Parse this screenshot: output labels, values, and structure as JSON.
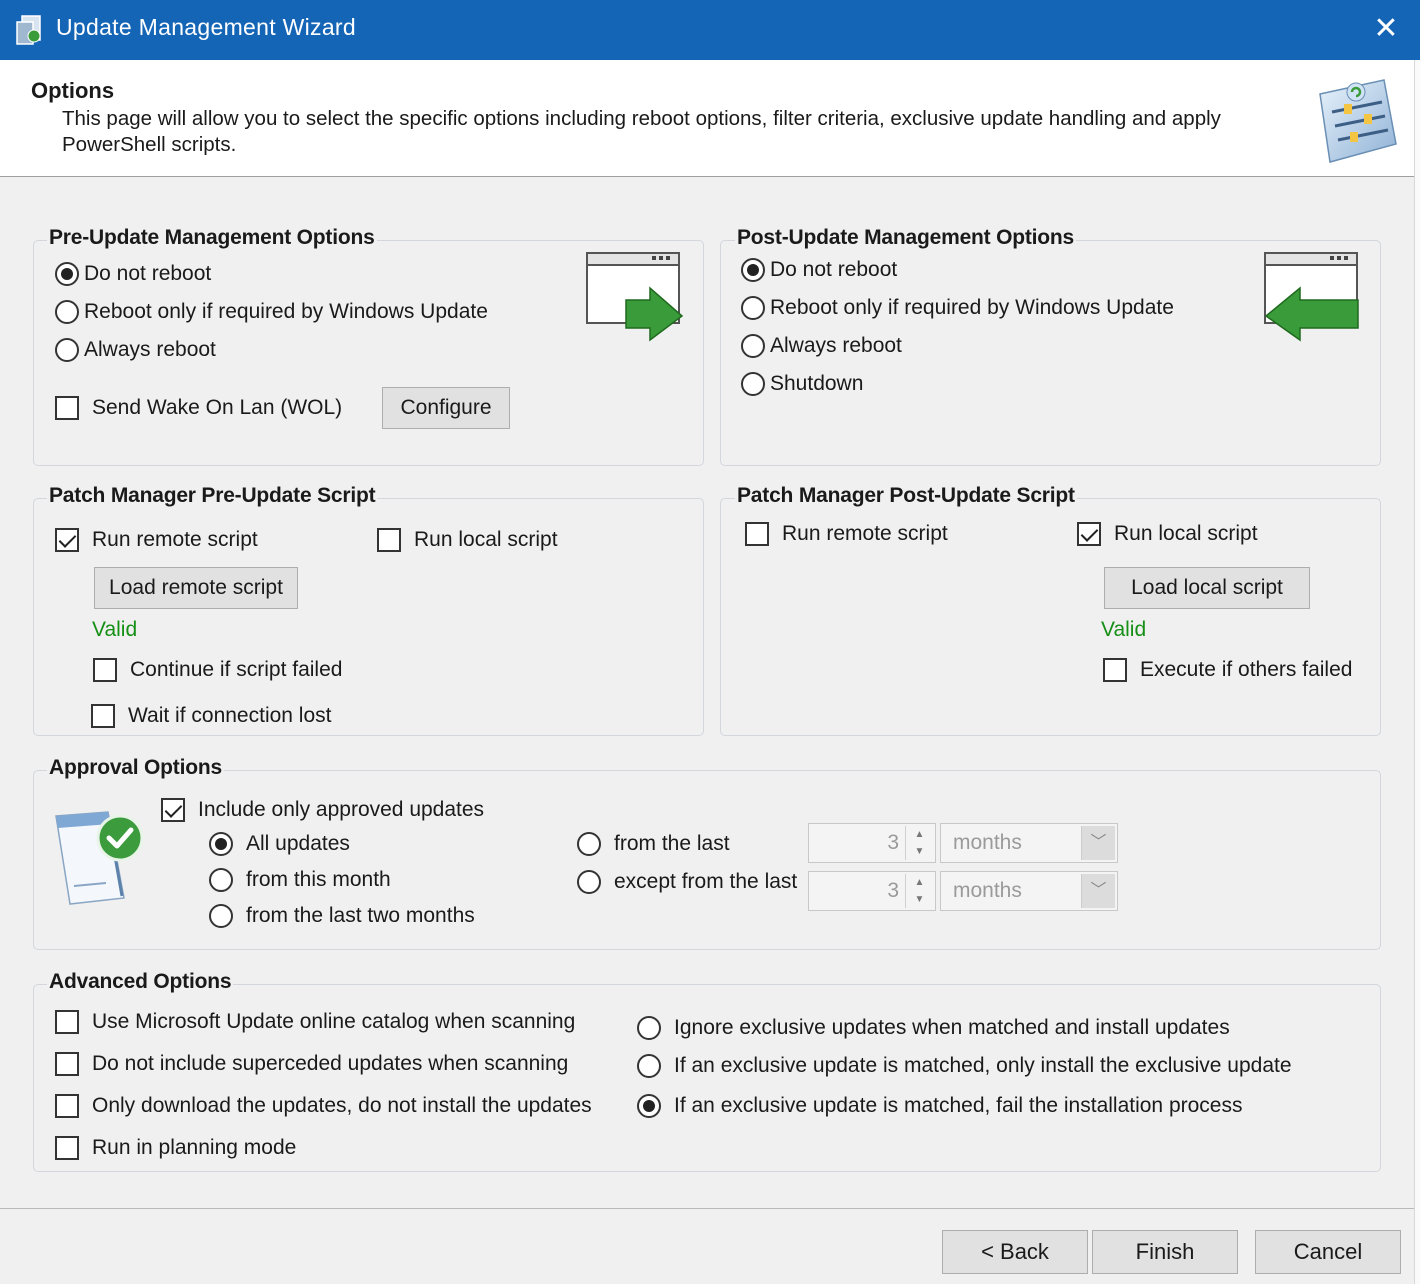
{
  "window": {
    "title": "Update Management Wizard",
    "close_glyph": "✕",
    "title_bar_color": "#1565b7"
  },
  "header": {
    "title": "Options",
    "description": "This page will allow you to select the specific options including reboot options, filter criteria, exclusive update handling and apply PowerShell scripts."
  },
  "pre_update": {
    "title": "Pre-Update Management Options",
    "options": [
      {
        "label": "Do not reboot",
        "selected": true
      },
      {
        "label": "Reboot only if required by Windows Update",
        "selected": false
      },
      {
        "label": "Always reboot",
        "selected": false
      }
    ],
    "wol_label": "Send Wake On Lan (WOL)",
    "wol_checked": false,
    "configure_label": "Configure"
  },
  "post_update": {
    "title": "Post-Update Management Options",
    "options": [
      {
        "label": "Do not reboot",
        "selected": true
      },
      {
        "label": "Reboot only if required by Windows Update",
        "selected": false
      },
      {
        "label": "Always reboot",
        "selected": false
      },
      {
        "label": "Shutdown",
        "selected": false
      }
    ]
  },
  "pre_script": {
    "title": "Patch Manager Pre-Update Script",
    "run_remote_label": "Run remote script",
    "run_remote_checked": true,
    "run_local_label": "Run local script",
    "run_local_checked": false,
    "load_label": "Load remote script",
    "status": "Valid",
    "continue_label": "Continue if script failed",
    "wait_label": "Wait if connection lost"
  },
  "post_script": {
    "title": "Patch Manager Post-Update Script",
    "run_remote_label": "Run remote script",
    "run_remote_checked": false,
    "run_local_label": "Run local script",
    "run_local_checked": true,
    "load_label": "Load local script",
    "status": "Valid",
    "execute_label": "Execute if others failed"
  },
  "approval": {
    "title": "Approval Options",
    "include_label": "Include only approved updates",
    "include_checked": true,
    "all_updates": "All updates",
    "this_month": "from this month",
    "last_two_months": "from the last two months",
    "from_last": "from the last",
    "except_from_last": "except from the last",
    "from_last_value": "3",
    "from_last_unit": "months",
    "except_value": "3",
    "except_unit": "months"
  },
  "advanced": {
    "title": "Advanced Options",
    "checks": [
      "Use Microsoft Update online catalog when scanning",
      "Do not include superceded updates when scanning",
      "Only download the updates, do not install the updates",
      "Run in planning mode"
    ],
    "exclusive": [
      "Ignore exclusive updates when matched and install updates",
      "If an exclusive update is matched, only install the exclusive update",
      "If an exclusive update is matched, fail the installation process"
    ],
    "exclusive_selected_index": 2
  },
  "footer": {
    "back": "< Back",
    "finish": "Finish",
    "cancel": "Cancel"
  }
}
